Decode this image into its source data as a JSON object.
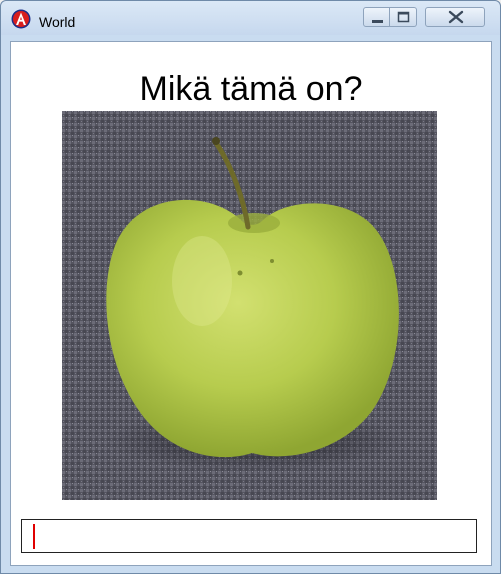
{
  "window": {
    "title": "World",
    "app_icon": "red-a-logo-icon",
    "controls": [
      "minimize-icon",
      "maximize-icon",
      "close-icon"
    ]
  },
  "main": {
    "question": "Mikä tämä on?",
    "image_subject": "green-apple-photo",
    "answer": {
      "value": "",
      "placeholder": ""
    }
  },
  "colors": {
    "titlebar": "#c6d8ee",
    "caret": "#e00000",
    "apple": "#b8d050",
    "background_fabric": "#5a5a66"
  }
}
